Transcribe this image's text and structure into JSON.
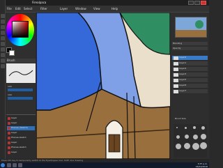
{
  "title": "Firealpaca",
  "menu": [
    "File",
    "Edit",
    "Select",
    "Filter",
    "Layer",
    "Window",
    "View",
    "Help"
  ],
  "left_panel": {
    "brush_header": "Brush",
    "sliders": [
      "100",
      "100"
    ],
    "layers": [
      "Layer",
      "Layer",
      "Phones (Sketch)",
      "Layer",
      "Phones sketch",
      "Layer",
      "Phones sketch",
      "Layer"
    ]
  },
  "right_panel": {
    "controls": [
      "Blending",
      "Opacity"
    ],
    "layers": [
      "Layer2",
      "Layer1",
      "Layer4",
      "Layer3",
      "Layer5",
      "Layer6",
      "Layer7"
    ],
    "brush_size_label": "Brush Size"
  },
  "status_text": "Press Ctrl key to temporarily switch to the Eyedropper tool. Shift: line drawing",
  "clock": {
    "time": "3:37 p.m.",
    "date": "16/12/2016"
  }
}
